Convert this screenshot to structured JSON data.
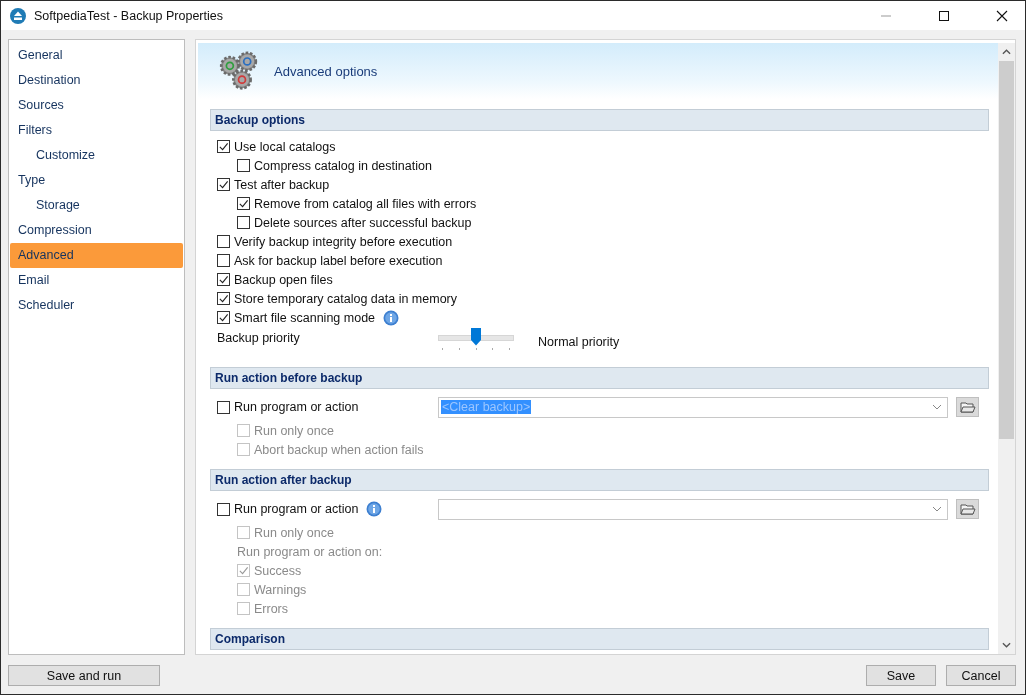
{
  "window": {
    "title": "SoftpediaTest - Backup Properties"
  },
  "sidebar": {
    "items": [
      {
        "label": "General",
        "selected": false
      },
      {
        "label": "Destination",
        "selected": false
      },
      {
        "label": "Sources",
        "selected": false
      },
      {
        "label": "Filters",
        "selected": false,
        "children": [
          {
            "label": "Customize",
            "selected": false
          }
        ]
      },
      {
        "label": "Type",
        "selected": false,
        "children": [
          {
            "label": "Storage",
            "selected": false
          }
        ]
      },
      {
        "label": "Compression",
        "selected": false
      },
      {
        "label": "Advanced",
        "selected": true
      },
      {
        "label": "Email",
        "selected": false
      },
      {
        "label": "Scheduler",
        "selected": false
      }
    ]
  },
  "header": {
    "title": "Advanced options"
  },
  "sections": [
    {
      "title": "Backup options",
      "rows": [
        {
          "kind": "checkbox",
          "label": "Use local catalogs",
          "checked": true,
          "disabled": false,
          "children": [
            {
              "kind": "checkbox",
              "label": "Compress catalog in destination",
              "checked": false,
              "disabled": false
            }
          ]
        },
        {
          "kind": "checkbox",
          "label": "Test after backup",
          "checked": true,
          "disabled": false,
          "children": [
            {
              "kind": "checkbox",
              "label": "Remove from catalog all files with errors",
              "checked": true,
              "disabled": false
            },
            {
              "kind": "checkbox",
              "label": "Delete sources after successful backup",
              "checked": false,
              "disabled": false
            }
          ]
        },
        {
          "kind": "checkbox",
          "label": "Verify backup integrity before execution",
          "checked": false,
          "disabled": false
        },
        {
          "kind": "checkbox",
          "label": "Ask for backup label before execution",
          "checked": false,
          "disabled": false
        },
        {
          "kind": "checkbox",
          "label": "Backup open files",
          "checked": true,
          "disabled": false
        },
        {
          "kind": "checkbox",
          "label": "Store temporary catalog data in memory",
          "checked": true,
          "disabled": false
        },
        {
          "kind": "checkbox",
          "label": "Smart file scanning mode",
          "checked": true,
          "disabled": false,
          "info": true
        },
        {
          "kind": "slider",
          "label": "Backup priority",
          "level": 0.5,
          "reading": "Normal priority"
        }
      ]
    },
    {
      "title": "Run action before backup",
      "rows": [
        {
          "kind": "action",
          "label": "Run program or action",
          "checked": false,
          "disabled": false,
          "combo": {
            "value": "<Clear backup>",
            "highlighted": true
          },
          "children": [
            {
              "kind": "checkbox",
              "label": "Run only once",
              "checked": false,
              "disabled": true
            },
            {
              "kind": "checkbox",
              "label": "Abort backup when action fails",
              "checked": false,
              "disabled": true
            }
          ]
        }
      ]
    },
    {
      "title": "Run action after backup",
      "rows": [
        {
          "kind": "action",
          "label": "Run program or action",
          "checked": false,
          "disabled": false,
          "info": true,
          "children": [
            {
              "kind": "checkbox",
              "label": "Run only once",
              "checked": false,
              "disabled": true
            },
            {
              "kind": "label",
              "label": "Run program or action on:",
              "disabled": true
            },
            {
              "kind": "checkbox",
              "label": "Success",
              "checked": true,
              "disabled": true
            },
            {
              "kind": "checkbox",
              "label": "Warnings",
              "checked": false,
              "disabled": true
            },
            {
              "kind": "checkbox",
              "label": "Errors",
              "checked": false,
              "disabled": true
            }
          ]
        }
      ]
    },
    {
      "title": "Comparison"
    }
  ],
  "footer": {
    "left_buttons": [
      "Save and run"
    ],
    "right_buttons": [
      "Save",
      "Cancel"
    ]
  }
}
